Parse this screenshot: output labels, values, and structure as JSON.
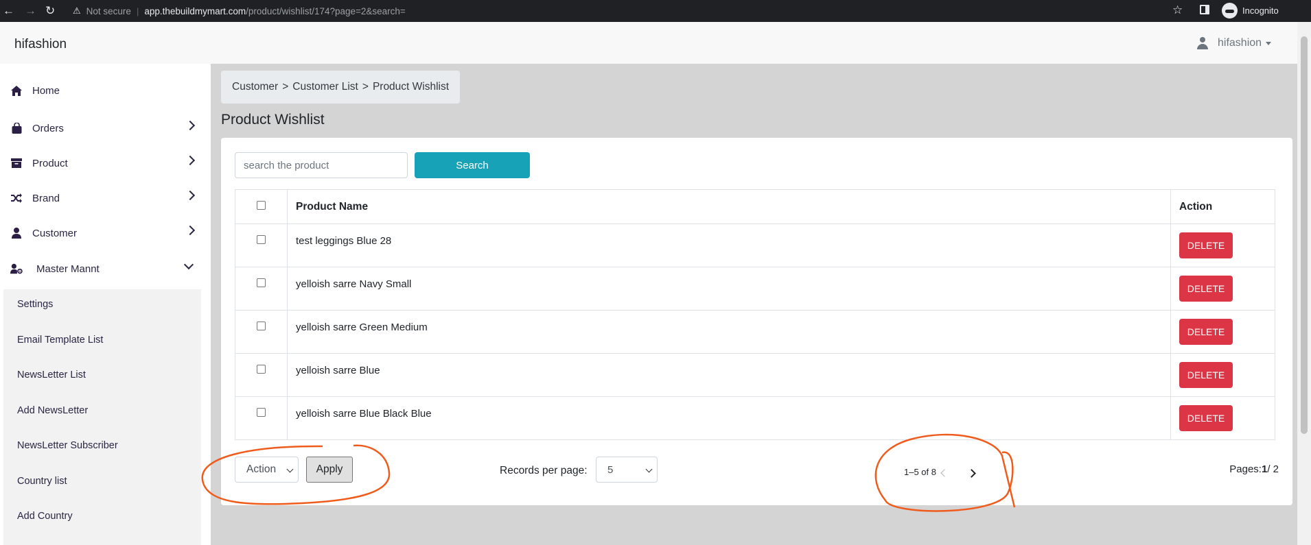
{
  "browser": {
    "security_label": "Not secure",
    "url_host": "app.thebuildmymart.com",
    "url_path": "/product/wishlist/174?page=2&search=",
    "profile_label": "Incognito"
  },
  "navbar": {
    "brand": "hifashion",
    "user_name": "hifashion"
  },
  "sidebar": {
    "items": [
      {
        "label": "Home",
        "icon": "home-icon"
      },
      {
        "label": "Orders",
        "icon": "shopping-bag-icon"
      },
      {
        "label": "Product",
        "icon": "archive-box-icon"
      },
      {
        "label": "Brand",
        "icon": "shuffle-icon"
      },
      {
        "label": "Customer",
        "icon": "user-icon"
      },
      {
        "label": "Master Mannt",
        "icon": "user-gear-icon"
      }
    ],
    "submenu": [
      "Settings",
      "Email Template List",
      "NewsLetter List",
      "Add NewsLetter",
      "NewsLetter Subscriber",
      "Country list",
      "Add Country"
    ]
  },
  "breadcrumb": [
    "Customer",
    "Customer List",
    "Product Wishlist"
  ],
  "breadcrumb_separator": ">",
  "page": {
    "title": "Product Wishlist",
    "search_placeholder": "search the product",
    "search_button": "Search"
  },
  "table": {
    "columns": [
      "Product Name",
      "Action"
    ],
    "rows": [
      {
        "name": "test leggings Blue 28",
        "action": "DELETE"
      },
      {
        "name": "yelloish sarre Navy Small",
        "action": "DELETE"
      },
      {
        "name": "yelloish sarre Green Medium",
        "action": "DELETE"
      },
      {
        "name": "yelloish sarre Blue",
        "action": "DELETE"
      },
      {
        "name": "yelloish sarre Blue Black Blue",
        "action": "DELETE"
      }
    ]
  },
  "footer": {
    "bulk_action_selected": "Action",
    "apply_label": "Apply",
    "records_per_page_label": "Records per page:",
    "records_per_page_value": "5",
    "range_text": "1–5 of 8",
    "pages_label": "Pages:",
    "current_page": "1",
    "total_pages": "/ 2"
  },
  "colors": {
    "primary_button": "#17a2b8",
    "danger_button": "#dc3545",
    "annotation": "#f05a1a"
  }
}
